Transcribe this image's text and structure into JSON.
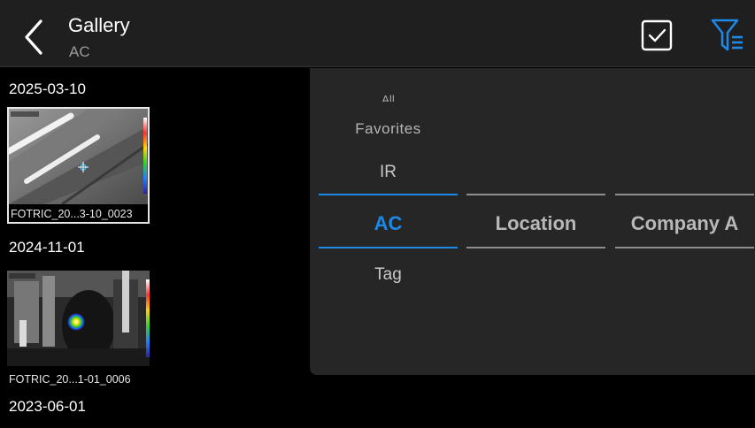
{
  "header": {
    "title": "Gallery",
    "subtitle": "AC",
    "back_icon": "chevron-left-icon",
    "select_icon": "checkbox-icon",
    "filter_icon": "filter-list-icon",
    "accent_color": "#1e88e5"
  },
  "gallery": {
    "groups": [
      {
        "date": "2025-03-10",
        "items": [
          {
            "label": "FOTRIC_20...3-10_0023",
            "selected": true
          }
        ]
      },
      {
        "date": "2024-11-01",
        "items": [
          {
            "label": "FOTRIC_20...1-01_0006",
            "selected": false
          }
        ]
      },
      {
        "date": "2023-06-01",
        "items": []
      }
    ]
  },
  "filter_panel": {
    "category_column": {
      "items": [
        "All",
        "Favorites",
        "IR",
        "AC",
        "Tag"
      ],
      "selected": "AC"
    },
    "location_column": {
      "selected": "Location"
    },
    "company_column": {
      "selected": "Company A"
    }
  }
}
